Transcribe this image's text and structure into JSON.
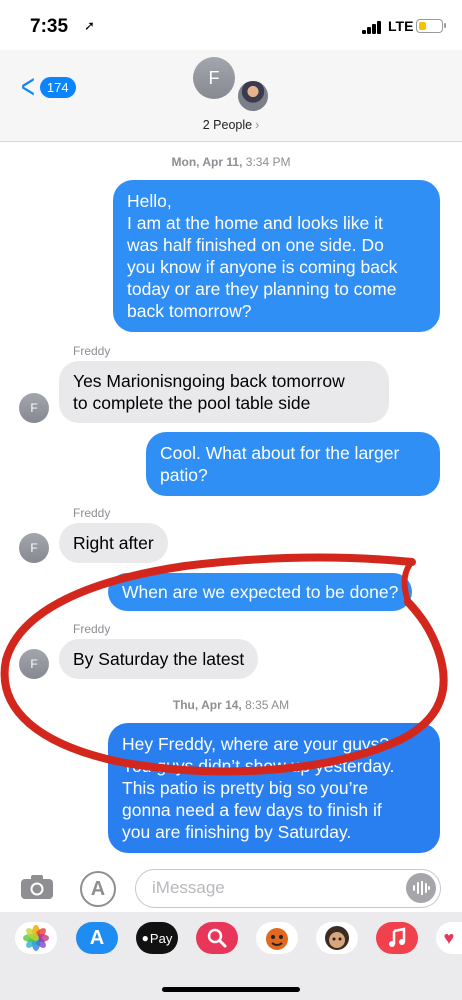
{
  "status": {
    "time": "7:35",
    "network": "LTE"
  },
  "header": {
    "back_count": "174",
    "avatar_initial": "F",
    "people_label": "2 People"
  },
  "messages": {
    "stamp1_day": "Mon, Apr 11,",
    "stamp1_time": "3:34 PM",
    "out1": [
      "Hello,",
      "I am at the home and looks like it",
      "was half finished on one side. Do",
      "you know if anyone is coming back",
      "today or are they planning to come",
      "back tomorrow?"
    ],
    "sender_name": "Freddy",
    "in1": [
      "Yes Marionisngoing back tomorrow",
      "to complete the pool table side"
    ],
    "out2": [
      "Cool. What about for the larger",
      "patio?"
    ],
    "in2": "Right after",
    "out3": "When are we expected to be done?",
    "in3": "By Saturday the latest",
    "stamp2_day": "Thu, Apr 14,",
    "stamp2_time": "8:35 AM",
    "out4": [
      "Hey Freddy, where are your guys?",
      "You guys didn’t show up yesterday.",
      "This patio is pretty big so you’re",
      "gonna need a few days to finish if",
      "you are finishing by Saturday."
    ]
  },
  "input": {
    "placeholder": "iMessage"
  },
  "drawer": {
    "apple_pay_label": "Pay"
  },
  "colors": {
    "accent": "#0a84ff",
    "outgoing_bubble": "#2f8ff5",
    "incoming_bubble": "#e9e9eb",
    "annotation": "#d3271d"
  },
  "icons": [
    "location-arrow-icon",
    "signal-icon",
    "battery-icon",
    "back-chevron-icon",
    "camera-icon",
    "app-store-icon",
    "voice-waveform-icon",
    "photos-app-icon",
    "music-app-icon"
  ]
}
